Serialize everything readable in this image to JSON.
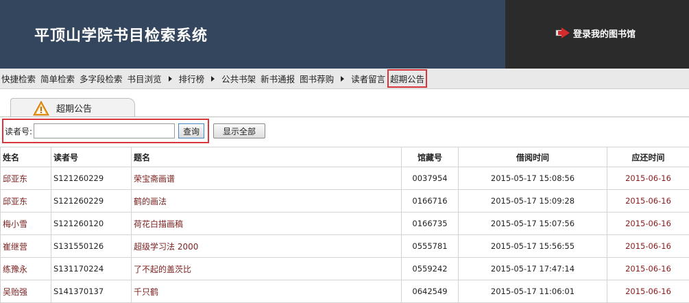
{
  "header": {
    "title": "平顶山学院书目检索系统",
    "login_label": "登录我的图书馆"
  },
  "nav": {
    "items": [
      {
        "label": "快捷检索",
        "sep": false
      },
      {
        "label": "简单检索",
        "sep": false
      },
      {
        "label": "多字段检索",
        "sep": false
      },
      {
        "label": "书目浏览",
        "sep": true
      },
      {
        "label": "排行榜",
        "sep": true
      },
      {
        "label": "公共书架",
        "sep": false
      },
      {
        "label": "新书通报",
        "sep": false
      },
      {
        "label": "图书荐购",
        "sep": true
      },
      {
        "label": "读者留言",
        "sep": false
      },
      {
        "label": "超期公告",
        "sep": false,
        "active": true
      }
    ]
  },
  "tab": {
    "label": "超期公告",
    "icon": "warning-icon"
  },
  "search": {
    "label": "读者号:",
    "value": "",
    "query_button": "查询",
    "show_all_button": "显示全部"
  },
  "table": {
    "headers": [
      "姓名",
      "读者号",
      "题名",
      "馆藏号",
      "借阅时间",
      "应还时间"
    ],
    "rows": [
      {
        "name": "邱亚东",
        "reader_id": "S121260229",
        "title": "荣宝斋画谱",
        "call_no": "0037954",
        "borrow_time": "2015-05-17 15:08:56",
        "due": "2015-06-16"
      },
      {
        "name": "邱亚东",
        "reader_id": "S121260229",
        "title": "鹤的画法",
        "call_no": "0166716",
        "borrow_time": "2015-05-17 15:09:28",
        "due": "2015-06-16"
      },
      {
        "name": "梅小雪",
        "reader_id": "S121260120",
        "title": "荷花白描画稿",
        "call_no": "0166735",
        "borrow_time": "2015-05-17 15:07:56",
        "due": "2015-06-16"
      },
      {
        "name": "崔继营",
        "reader_id": "S131550126",
        "title": "超级学习法 2000",
        "call_no": "0555781",
        "borrow_time": "2015-05-17 15:56:55",
        "due": "2015-06-16"
      },
      {
        "name": "练豫永",
        "reader_id": "S131170224",
        "title": "了不起的盖茨比",
        "call_no": "0559242",
        "borrow_time": "2015-05-17 17:47:14",
        "due": "2015-06-16"
      },
      {
        "name": "吴贻强",
        "reader_id": "S141370137",
        "title": "千只鹤",
        "call_no": "0642549",
        "borrow_time": "2015-05-17 11:06:01",
        "due": "2015-06-16"
      }
    ]
  }
}
